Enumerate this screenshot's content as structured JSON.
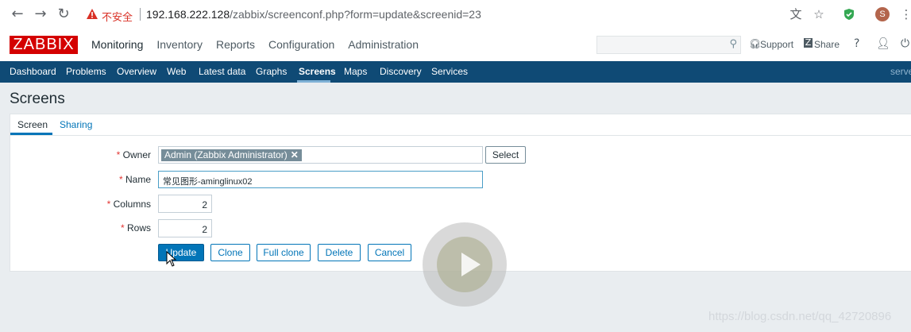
{
  "browser": {
    "back_icon": "arrow-left",
    "forward_icon": "arrow-right",
    "reload_icon": "reload",
    "insecure_label": "不安全",
    "url_host": "192.168.222.128",
    "url_path": "/zabbix/screenconf.php?form=update&screenid=23",
    "avatar_letter": "S"
  },
  "header": {
    "logo": "ZABBIX",
    "menu": [
      "Monitoring",
      "Inventory",
      "Reports",
      "Configuration",
      "Administration"
    ],
    "active_menu": "Monitoring",
    "support_label": "Support",
    "share_label": "Share",
    "help_label": "?"
  },
  "subnav": {
    "items": [
      "Dashboard",
      "Problems",
      "Overview",
      "Web",
      "Latest data",
      "Graphs",
      "Screens",
      "Maps",
      "Discovery",
      "Services"
    ],
    "active": "Screens",
    "right_label": "serve"
  },
  "page": {
    "title": "Screens",
    "tabs": [
      "Screen",
      "Sharing"
    ]
  },
  "form": {
    "owner_label": "Owner",
    "owner_value": "Admin (Zabbix Administrator)",
    "select_label": "Select",
    "name_label": "Name",
    "name_value": "常见图形-aminglinux02",
    "columns_label": "Columns",
    "columns_value": "2",
    "rows_label": "Rows",
    "rows_value": "2",
    "required_mark": "*"
  },
  "actions": {
    "update": "Update",
    "clone": "Clone",
    "full_clone": "Full clone",
    "delete": "Delete",
    "cancel": "Cancel"
  },
  "watermark": "https://blog.csdn.net/qq_42720896",
  "colors": {
    "brand_red": "#d40000",
    "subnav_bg": "#0f4a75",
    "accent_blue": "#0275b8"
  }
}
